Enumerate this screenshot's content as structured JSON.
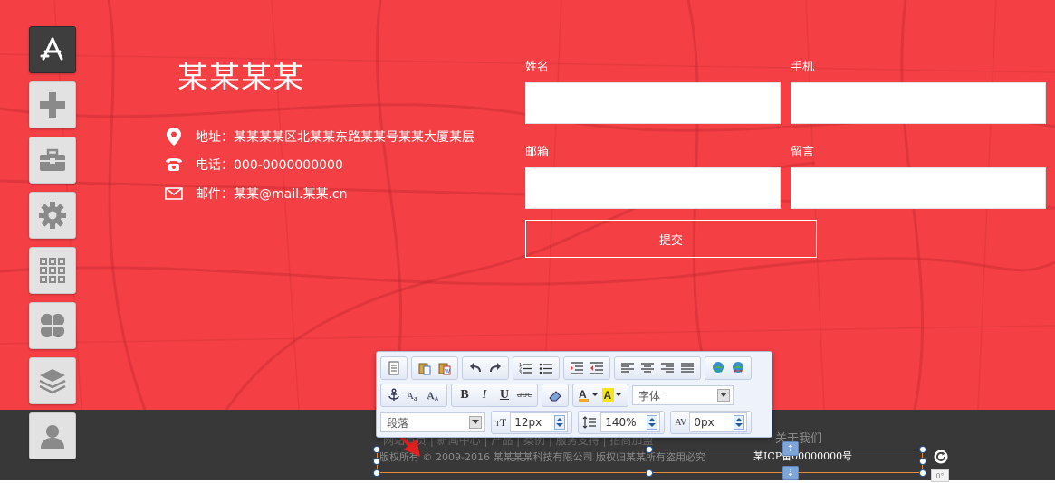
{
  "sidebar": {
    "items": [
      {
        "id": "app-store",
        "icon": "app-store-icon",
        "active": true
      },
      {
        "id": "add",
        "icon": "plus-icon",
        "active": false
      },
      {
        "id": "toolbox",
        "icon": "briefcase-icon",
        "active": false
      },
      {
        "id": "settings",
        "icon": "gear-icon",
        "active": false
      },
      {
        "id": "grid",
        "icon": "grid-icon",
        "active": false
      },
      {
        "id": "modules",
        "icon": "clover-icon",
        "active": false
      },
      {
        "id": "layers",
        "icon": "layers-icon",
        "active": false
      },
      {
        "id": "user",
        "icon": "user-icon",
        "active": false
      }
    ]
  },
  "contact": {
    "company": "某某某某",
    "address": "地址：某某某某区北某某东路某某号某某大厦某层",
    "phone": "电话：000-0000000000",
    "email": "邮件：某某@mail.某某.cn"
  },
  "form": {
    "name_label": "姓名",
    "phone_label": "手机",
    "email_label": "邮箱",
    "message_label": "留言",
    "name_value": "",
    "phone_value": "",
    "email_value": "",
    "message_value": "",
    "submit_label": "提交"
  },
  "editor": {
    "font_family_placeholder": "字体",
    "paragraph_label": "段落",
    "font_size": "12px",
    "line_height": "140%",
    "letter_spacing": "0px",
    "text_color_label": "A",
    "bg_color_label": "A",
    "bold": "B",
    "italic": "I",
    "underline": "U",
    "strike": "abc"
  },
  "footer": {
    "about": "关于我们",
    "copyright": "版权所有 © 2009-2016 某某某某科技有限公司 版权归某某所有盗用必究",
    "icp": "某ICP备00000000号",
    "nav": "网站首页 | 新闻中心 | 产品 | 案例 | 服务支持 | 招商加盟"
  },
  "colors": {
    "hero_bg": "#f43f45",
    "footer_bg": "#383838",
    "toolbar_active": "#3e3e3e"
  }
}
